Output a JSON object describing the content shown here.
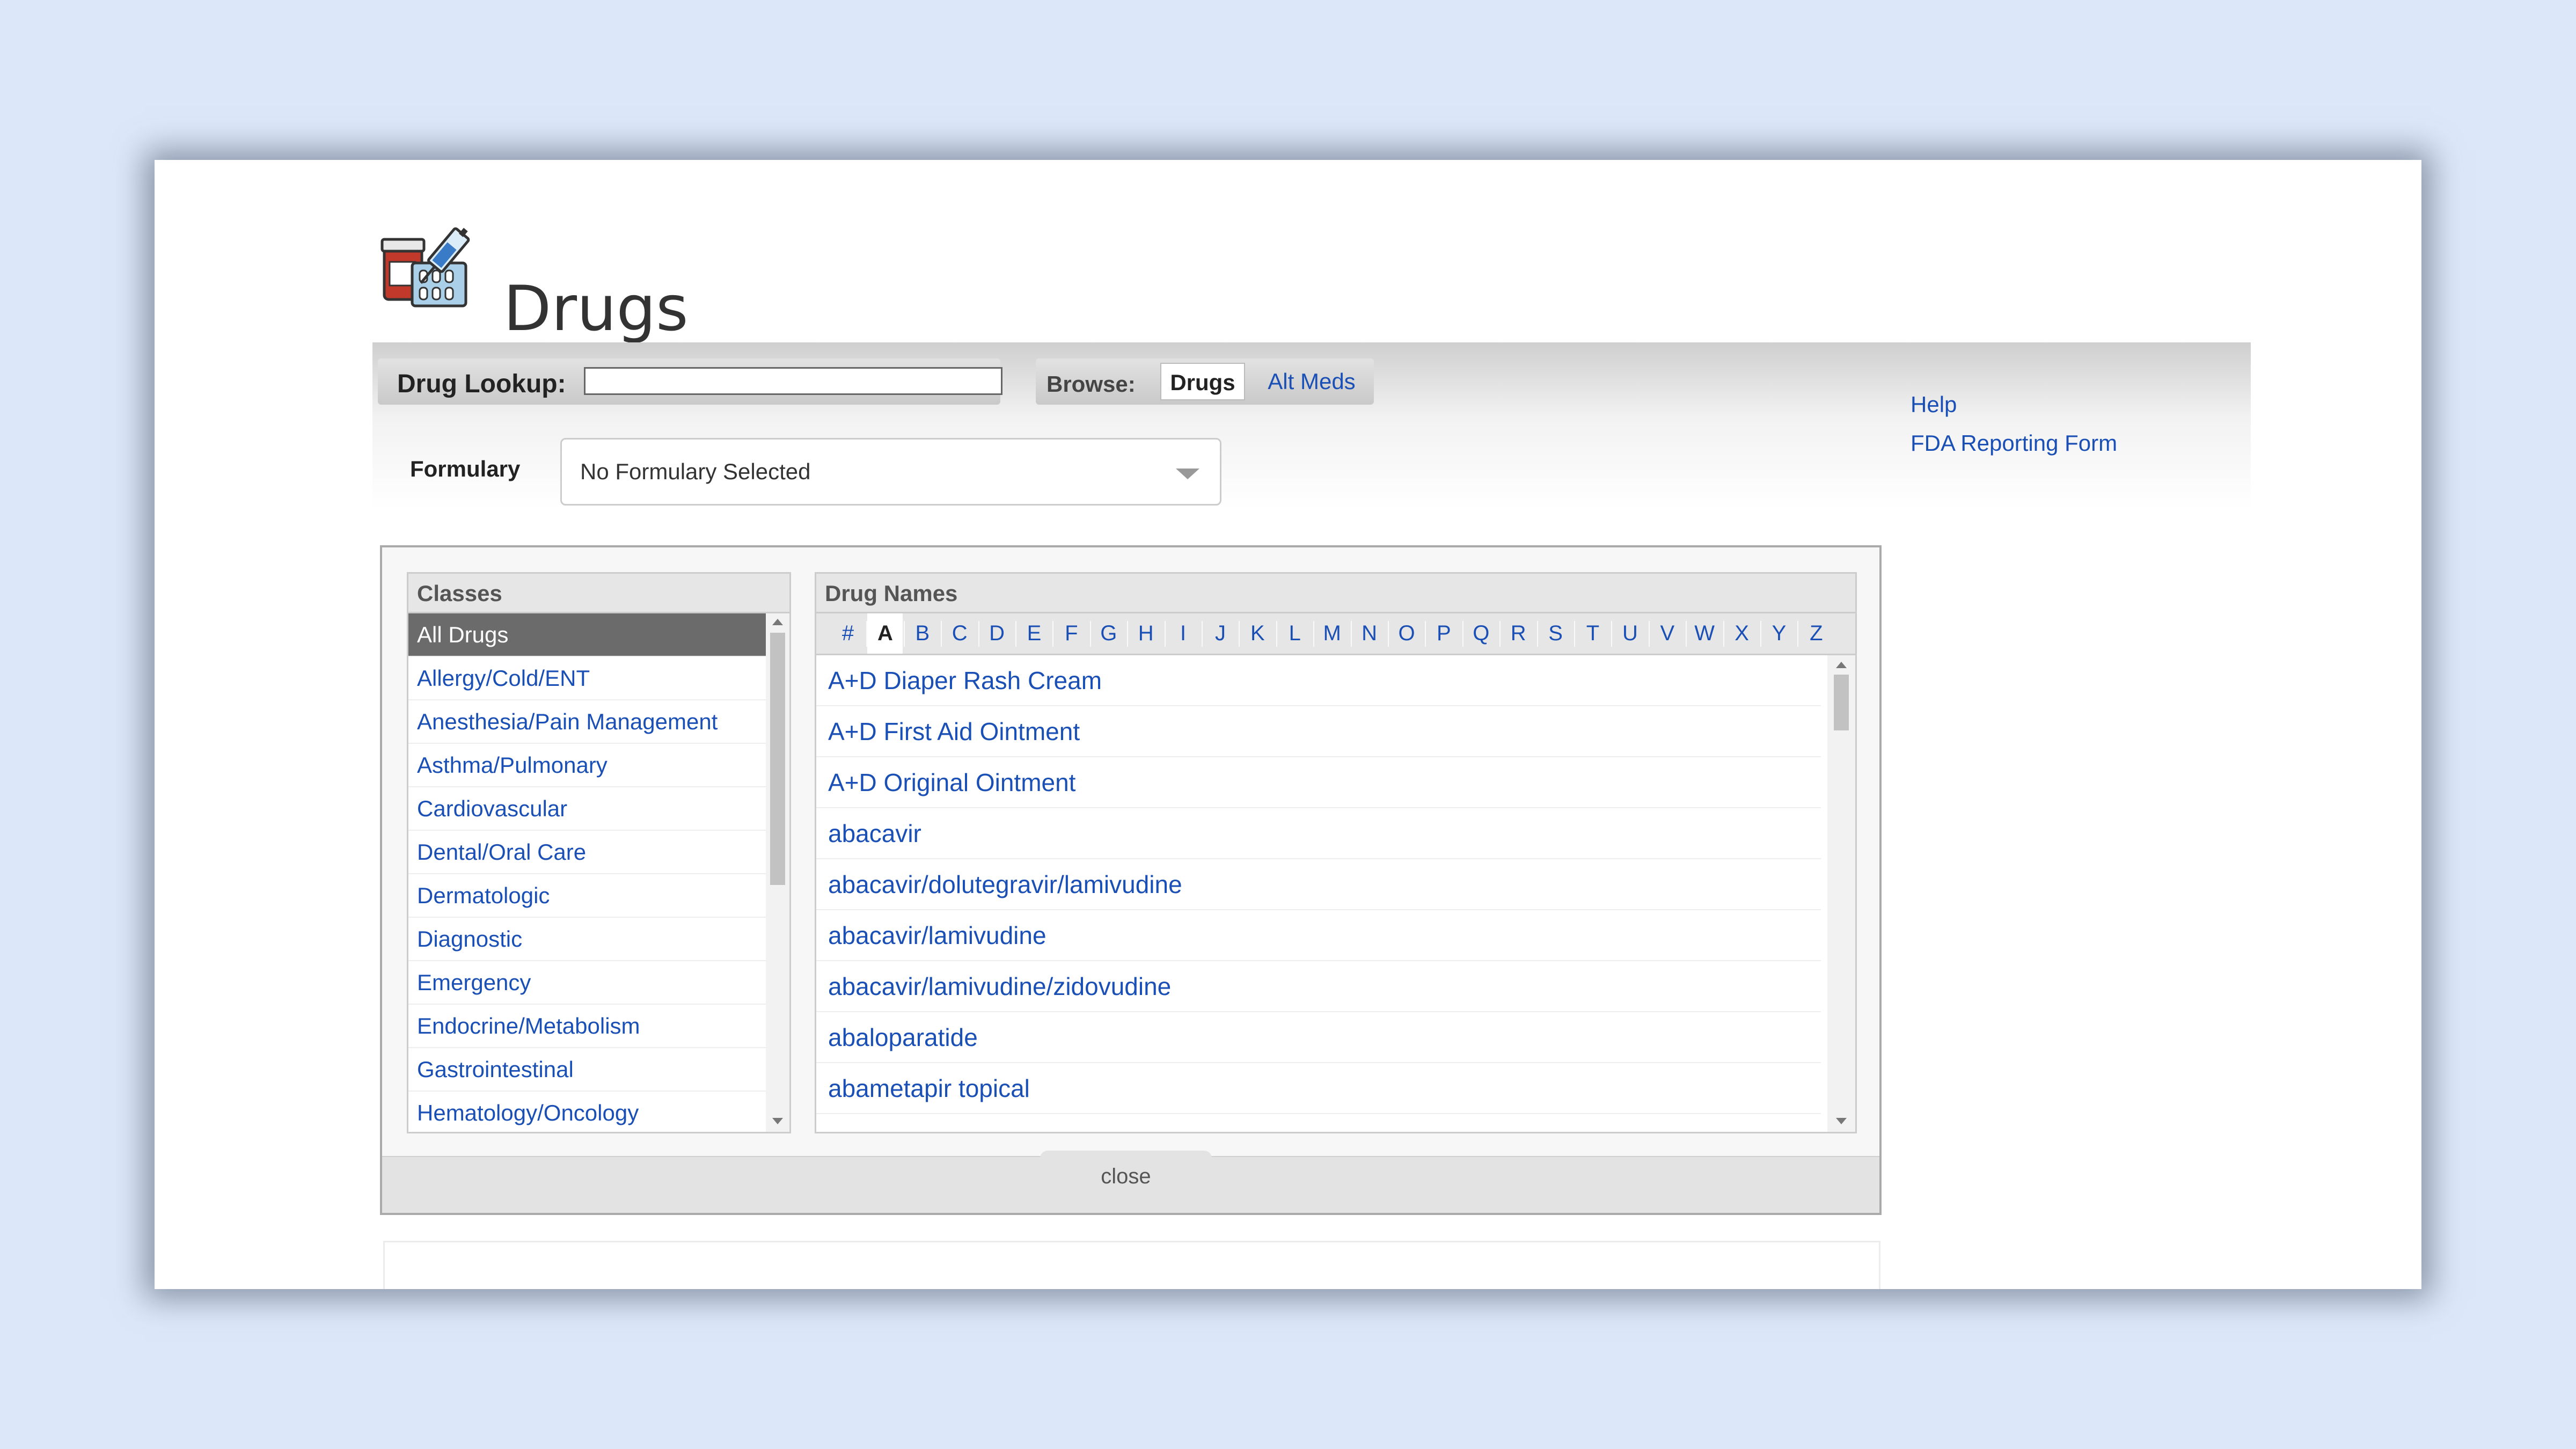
{
  "header": {
    "title": "Drugs",
    "logo_icon": "drug-pills-syringe-icon"
  },
  "lookup": {
    "label": "Drug Lookup:",
    "value": "",
    "placeholder": ""
  },
  "browse": {
    "label": "Browse:",
    "tabs": [
      {
        "label": "Drugs",
        "active": true
      },
      {
        "label": "Alt Meds",
        "active": false
      }
    ]
  },
  "formulary": {
    "label": "Formulary",
    "selected": "No Formulary Selected"
  },
  "side_links": [
    "Help",
    "FDA Reporting Form"
  ],
  "classes": {
    "header": "Classes",
    "items": [
      "All Drugs",
      "Allergy/Cold/ENT",
      "Anesthesia/Pain Management",
      "Asthma/Pulmonary",
      "Cardiovascular",
      "Dental/Oral Care",
      "Dermatologic",
      "Diagnostic",
      "Emergency",
      "Endocrine/Metabolism",
      "Gastrointestinal",
      "Hematology/Oncology"
    ],
    "active_index": 0
  },
  "drug_names": {
    "header": "Drug Names",
    "letters": [
      "#",
      "A",
      "B",
      "C",
      "D",
      "E",
      "F",
      "G",
      "H",
      "I",
      "J",
      "K",
      "L",
      "M",
      "N",
      "O",
      "P",
      "Q",
      "R",
      "S",
      "T",
      "U",
      "V",
      "W",
      "X",
      "Y",
      "Z"
    ],
    "active_letter": "A",
    "items": [
      "A+D Diaper Rash Cream",
      "A+D First Aid Ointment",
      "A+D Original Ointment",
      "abacavir",
      "abacavir/dolutegravir/lamivudine",
      "abacavir/lamivudine",
      "abacavir/lamivudine/zidovudine",
      "abaloparatide",
      "abametapir topical"
    ]
  },
  "close_label": "close",
  "colors": {
    "link": "#1a4fb5",
    "active_class_bg": "#6b6b6b",
    "page_bg": "#dce8fa"
  }
}
